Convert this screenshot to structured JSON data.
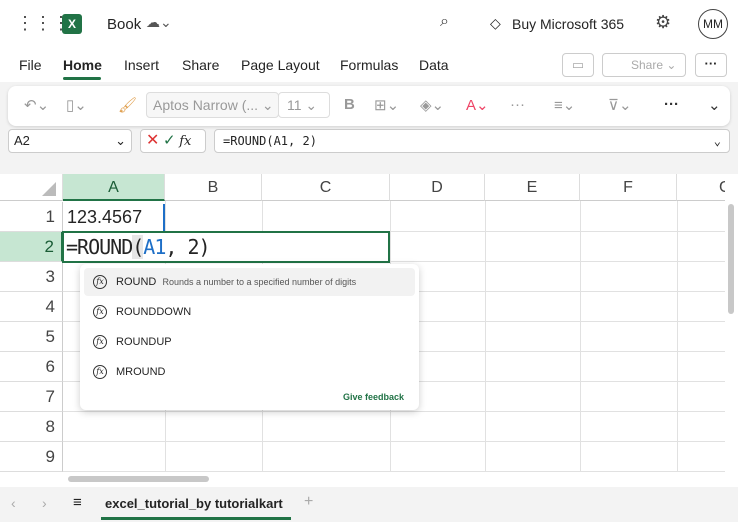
{
  "topbar": {
    "app_name": "Book",
    "buy": "Buy Microsoft 365",
    "avatar": "MM"
  },
  "tabs": [
    "File",
    "Home",
    "Insert",
    "Share",
    "Page Layout",
    "Formulas",
    "Data"
  ],
  "share_label": "Share",
  "ribbon": {
    "font": "Aptos Narrow (...",
    "size": "11"
  },
  "namebox": "A2",
  "formula": "=ROUND(A1, 2)",
  "columns": [
    "A",
    "B",
    "C",
    "D",
    "E",
    "F",
    "G"
  ],
  "rows": [
    "1",
    "2",
    "3",
    "4",
    "5",
    "6",
    "7",
    "8",
    "9"
  ],
  "cells": {
    "A1": "123.4567",
    "A2_prefix": "=ROUND",
    "A2_paren": "(",
    "A2_ref": "A1",
    "A2_rest": ", 2)"
  },
  "autocomplete": {
    "items": [
      {
        "name": "ROUND",
        "desc": "Rounds a number to a specified number of digits"
      },
      {
        "name": "ROUNDDOWN"
      },
      {
        "name": "ROUNDUP"
      },
      {
        "name": "MROUND"
      }
    ],
    "feedback": "Give feedback"
  },
  "sheet_tab": "excel_tutorial_by tutorialkart",
  "colors": {
    "accent": "#217346",
    "select": "#c6e6d2"
  }
}
